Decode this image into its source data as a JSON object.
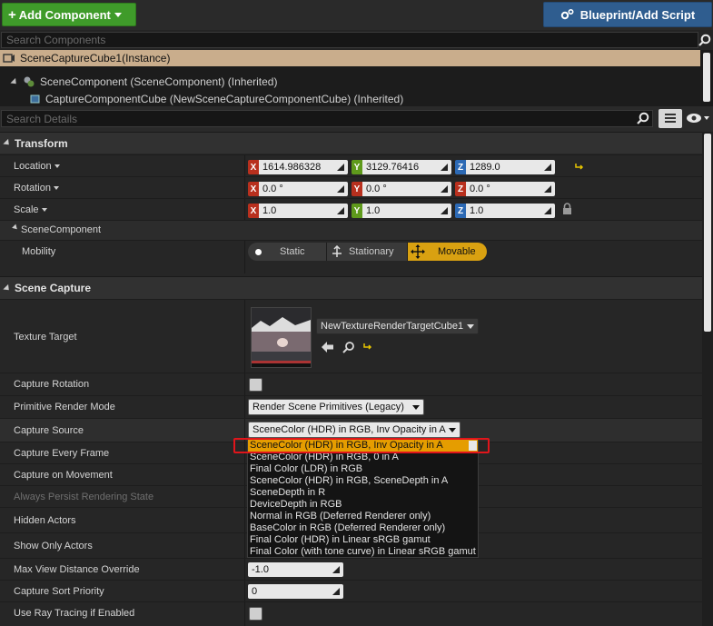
{
  "toolbar": {
    "add_component_label": "Add Component",
    "blueprint_label": "Blueprint/Add Script"
  },
  "components_search": {
    "placeholder": "Search Components"
  },
  "tree": {
    "instance": "SceneCaptureCube1(Instance)",
    "scene_component": "SceneComponent (SceneComponent) (Inherited)",
    "capture_component": "CaptureComponentCube (NewSceneCaptureComponentCube) (Inherited)"
  },
  "details_search": {
    "placeholder": "Search Details"
  },
  "transform": {
    "header": "Transform",
    "location_label": "Location",
    "rotation_label": "Rotation",
    "scale_label": "Scale",
    "location": {
      "x": "1614.986328",
      "y": "3129.76416",
      "z": "1289.0"
    },
    "rotation": {
      "x": "0.0 °",
      "y": "0.0 °",
      "z": "0.0 °"
    },
    "scale": {
      "x": "1.0",
      "y": "1.0",
      "z": "1.0"
    },
    "axis_x": "X",
    "axis_y": "Y",
    "axis_z": "Z",
    "scene_component_header": "SceneComponent",
    "mobility_label": "Mobility",
    "mobility_options": [
      "Static",
      "Stationary",
      "Movable"
    ],
    "mobility_selected": "Movable"
  },
  "scene_capture": {
    "header": "Scene Capture",
    "texture_target_label": "Texture Target",
    "texture_target_value": "NewTextureRenderTargetCube1",
    "capture_rotation_label": "Capture Rotation",
    "primitive_render_mode_label": "Primitive Render Mode",
    "primitive_render_mode_value": "Render Scene Primitives (Legacy)",
    "capture_source_label": "Capture Source",
    "capture_source_value": "SceneColor (HDR) in RGB, Inv Opacity in A",
    "capture_every_frame_label": "Capture Every Frame",
    "capture_on_movement_label": "Capture on Movement",
    "always_persist_label": "Always Persist Rendering State",
    "hidden_actors_label": "Hidden Actors",
    "show_only_actors_label": "Show Only Actors",
    "max_view_distance_label": "Max View Distance Override",
    "max_view_distance_value": "-1.0",
    "capture_sort_priority_label": "Capture Sort Priority",
    "capture_sort_priority_value": "0",
    "use_ray_tracing_label": "Use Ray Tracing if Enabled"
  },
  "capture_source_menu": {
    "options": [
      "SceneColor (HDR) in RGB, Inv Opacity in A",
      "SceneColor (HDR) in RGB, 0 in A",
      "Final Color (LDR) in RGB",
      "SceneColor (HDR) in RGB, SceneDepth in A",
      "SceneDepth in R",
      "DeviceDepth in RGB",
      "Normal in RGB (Deferred Renderer only)",
      "BaseColor in RGB (Deferred Renderer only)",
      "Final Color (HDR) in Linear sRGB gamut",
      "Final Color (with tone curve) in Linear sRGB gamut"
    ],
    "highlighted_index": 0
  },
  "colors": {
    "add_button": "#3f9b2a",
    "blueprint_button": "#2f5d8f",
    "instance_row": "#c9ad8c",
    "axis_x": "#b8301e",
    "axis_y": "#5f9a1c",
    "axis_z": "#2c69b4",
    "movable_active": "#d9a111",
    "menu_highlight": "#e59d00",
    "annotation_box": "#e0151b"
  }
}
